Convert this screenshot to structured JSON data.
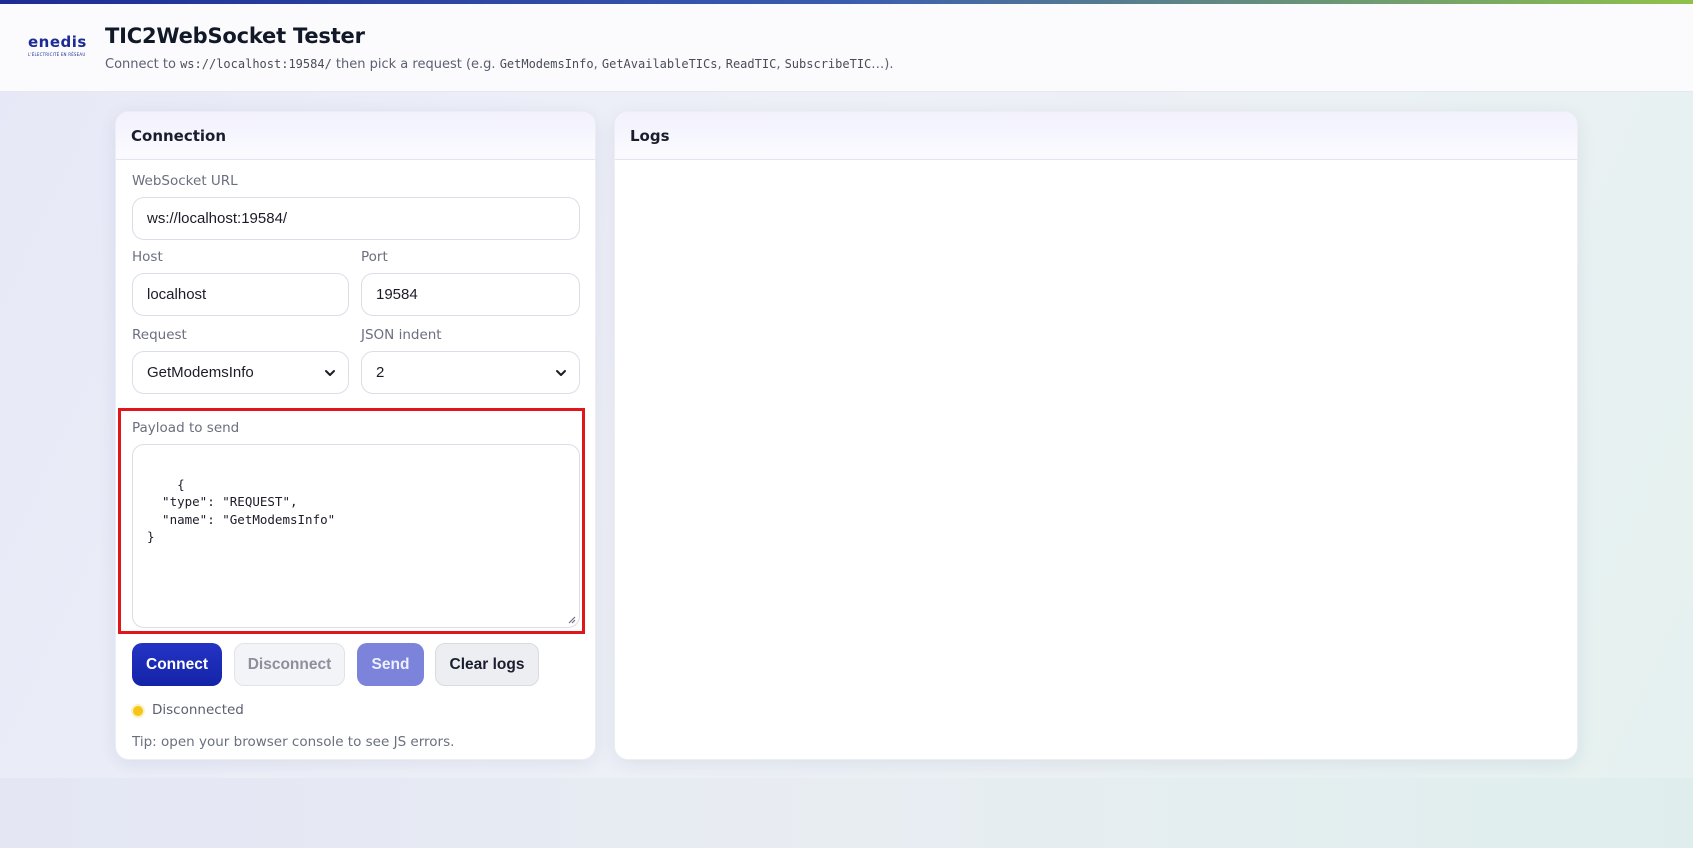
{
  "header": {
    "logo_text": "enedis",
    "logo_tagline": "L'ÉLECTRICITÉ EN RÉSEAU",
    "title": "TIC2WebSocket Tester",
    "subtitle_parts": [
      "Connect to ",
      "ws://localhost:19584/",
      " then pick a request (e.g. ",
      "GetModemsInfo",
      ", ",
      "GetAvailableTICs",
      ", ",
      "ReadTIC",
      ", ",
      "SubscribeTIC",
      "…)."
    ]
  },
  "connection": {
    "title": "Connection",
    "url_label": "WebSocket URL",
    "url_value": "ws://localhost:19584/",
    "host_label": "Host",
    "host_value": "localhost",
    "port_label": "Port",
    "port_value": "19584",
    "request_label": "Request",
    "request_value": "GetModemsInfo",
    "indent_label": "JSON indent",
    "indent_value": "2",
    "payload_label": "Payload to send",
    "payload_value": "{\n  \"type\": \"REQUEST\",\n  \"name\": \"GetModemsInfo\"\n}",
    "buttons": {
      "connect": "Connect",
      "disconnect": "Disconnect",
      "send": "Send",
      "clear": "Clear logs"
    },
    "status": "Disconnected",
    "tip": "Tip: open your browser console to see JS errors."
  },
  "logs": {
    "title": "Logs"
  },
  "colors": {
    "accent": "#1424a8",
    "send_disabled": "#7c83db",
    "status_disconnected": "#f5c518",
    "highlight": "#e0161b"
  },
  "icons": [
    "enedis-logo",
    "chevron-down-icon",
    "resize-handle-icon",
    "status-dot-icon"
  ]
}
